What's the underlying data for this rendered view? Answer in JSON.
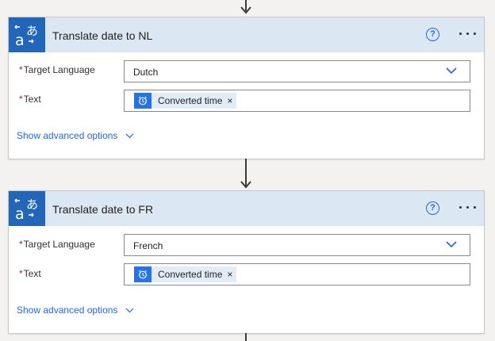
{
  "cards": [
    {
      "title": "Translate date to NL",
      "target_language_label": "Target Language",
      "target_language_value": "Dutch",
      "text_label": "Text",
      "required_marker": "*",
      "token_label": "Converted time",
      "token_remove": "×",
      "advanced_label": "Show advanced options"
    },
    {
      "title": "Translate date to FR",
      "target_language_label": "Target Language",
      "target_language_value": "French",
      "text_label": "Text",
      "required_marker": "*",
      "token_label": "Converted time",
      "token_remove": "×",
      "advanced_label": "Show advanced options"
    }
  ],
  "help_glyph": "?",
  "icons": {
    "action": "translator-icon",
    "help": "help-circle-icon",
    "more": "more-dots-icon",
    "dropdown": "chevron-down-icon",
    "token": "alarm-clock-icon"
  },
  "colors": {
    "header_bg": "#dce7f4",
    "action_icon_bg": "#2266b9",
    "token_icon_bg": "#2672e8",
    "link": "#2266e3",
    "required": "#a4262c"
  }
}
